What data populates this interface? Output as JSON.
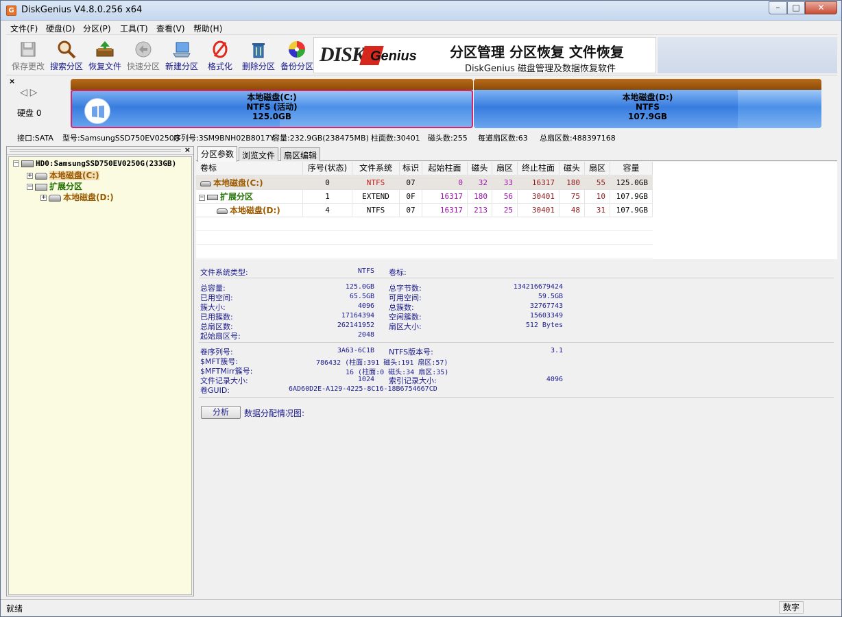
{
  "window": {
    "title": "DiskGenius V4.8.0.256 x64"
  },
  "menu": [
    "文件(F)",
    "硬盘(D)",
    "分区(P)",
    "工具(T)",
    "查看(V)",
    "帮助(H)"
  ],
  "toolbar": {
    "buttons": [
      {
        "label": "保存更改",
        "icon": "save-icon",
        "enabled": false
      },
      {
        "label": "搜索分区",
        "icon": "magnifier-icon",
        "enabled": true
      },
      {
        "label": "恢复文件",
        "icon": "restore-icon",
        "enabled": true
      },
      {
        "label": "快速分区",
        "icon": "quick-partition-icon",
        "enabled": false
      },
      {
        "label": "新建分区",
        "icon": "new-partition-icon",
        "enabled": true
      },
      {
        "label": "格式化",
        "icon": "format-icon",
        "enabled": true
      },
      {
        "label": "删除分区",
        "icon": "delete-icon",
        "enabled": true
      },
      {
        "label": "备份分区",
        "icon": "backup-icon",
        "enabled": true
      }
    ],
    "banner": {
      "logo_a": "DISK",
      "logo_b": "Genius",
      "title": "分区管理 分区恢复 文件恢复",
      "subtitle": "DiskGenius 磁盘管理及数据恢复软件"
    }
  },
  "diskmap": {
    "disk_label": "硬盘 0",
    "partitions": [
      {
        "name": "本地磁盘(C:)",
        "fs": "NTFS (活动)",
        "size": "125.0GB"
      },
      {
        "name": "本地磁盘(D:)",
        "fs": "NTFS",
        "size": "107.9GB"
      }
    ],
    "info": {
      "iface": "接口:SATA",
      "model": "型号:SamsungSSD750EV0250G",
      "serial": "序列号:3SM9BNH02B8017Y",
      "capacity": "容量:232.9GB(238475MB)",
      "cylinders": "柱面数:30401",
      "heads": "磁头数:255",
      "sectors_per_track": "每道扇区数:63",
      "total_sectors": "总扇区数:488397168"
    }
  },
  "tree": {
    "disk": "HD0:SamsungSSD750EV0250G(233GB)",
    "c": "本地磁盘(C:)",
    "ext": "扩展分区",
    "d": "本地磁盘(D:)"
  },
  "tabs": [
    "分区参数",
    "浏览文件",
    "扇区编辑"
  ],
  "table": {
    "headers": [
      "卷标",
      "序号(状态)",
      "文件系统",
      "标识",
      "起始柱面",
      "磁头",
      "扇区",
      "终止柱面",
      "磁头",
      "扇区",
      "容量"
    ],
    "rows": [
      {
        "vol": "本地磁盘(C:)",
        "idx": "0",
        "fs": "NTFS",
        "id": "07",
        "sc": "0",
        "sh": "32",
        "ss": "33",
        "ec": "16317",
        "eh": "180",
        "es": "55",
        "cap": "125.0GB"
      },
      {
        "vol": "扩展分区",
        "idx": "1",
        "fs": "EXTEND",
        "id": "0F",
        "sc": "16317",
        "sh": "180",
        "ss": "56",
        "ec": "30401",
        "eh": "75",
        "es": "10",
        "cap": "107.9GB"
      },
      {
        "vol": "本地磁盘(D:)",
        "idx": "4",
        "fs": "NTFS",
        "id": "07",
        "sc": "16317",
        "sh": "213",
        "ss": "25",
        "ec": "30401",
        "eh": "48",
        "es": "31",
        "cap": "107.9GB"
      }
    ]
  },
  "details": {
    "fs_type_label": "文件系统类型:",
    "fs_type": "NTFS",
    "vol_label": "卷标:",
    "total_cap_label": "总容量:",
    "total_cap": "125.0GB",
    "total_bytes_label": "总字节数:",
    "total_bytes": "134216679424",
    "used_label": "已用空间:",
    "used": "65.5GB",
    "free_label": "可用空间:",
    "free": "59.5GB",
    "cluster_size_label": "簇大小:",
    "cluster_size": "4096",
    "total_clusters_label": "总簇数:",
    "total_clusters": "32767743",
    "used_clusters_label": "已用簇数:",
    "used_clusters": "17164394",
    "free_clusters_label": "空闲簇数:",
    "free_clusters": "15603349",
    "total_sectors_label": "总扇区数:",
    "total_sectors": "262141952",
    "sector_size_label": "扇区大小:",
    "sector_size": "512 Bytes",
    "start_sector_label": "起始扇区号:",
    "start_sector": "2048",
    "serial_label": "卷序列号:",
    "serial": "3A63-6C1B",
    "ntfs_ver_label": "NTFS版本号:",
    "ntfs_ver": "3.1",
    "mft_label": "$MFT簇号:",
    "mft": "786432 (柱面:391 磁头:191 扇区:57)",
    "mftmirr_label": "$MFTMirr簇号:",
    "mftmirr": "16 (柱面:0 磁头:34 扇区:35)",
    "frs_label": "文件记录大小:",
    "frs": "1024",
    "irs_label": "索引记录大小:",
    "irs": "4096",
    "guid_label": "卷GUID:",
    "guid": "6AD60D2E-A129-4225-8C16-18B6754667CD",
    "analyze_btn": "分析",
    "analyze_label": "数据分配情况图:"
  },
  "status": {
    "left": "就绪",
    "right": "数字"
  }
}
